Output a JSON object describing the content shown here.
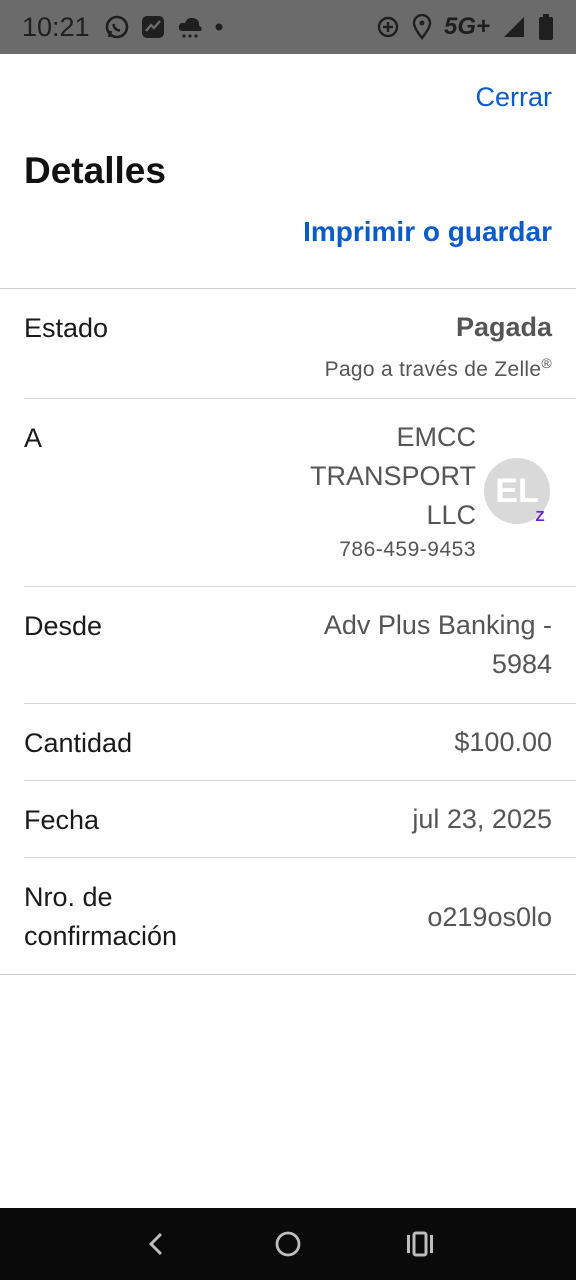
{
  "status_bar": {
    "time": "10:21",
    "network": "5G+",
    "left_icons": [
      "whatsapp-icon",
      "chart-app-icon",
      "weather-icon",
      "dot-icon"
    ],
    "right_icons": [
      "data-saver-icon",
      "location-icon",
      "signal-icon",
      "battery-icon"
    ]
  },
  "header": {
    "close_label": "Cerrar",
    "title": "Detalles",
    "print_label": "Imprimir o guardar"
  },
  "details": {
    "status": {
      "label": "Estado",
      "value": "Pagada",
      "sub_text": "Pago a través de Zelle",
      "sub_mark": "®"
    },
    "to": {
      "label": "A",
      "name": "EMCC TRANSPORT LLC",
      "phone": "786-459-9453",
      "avatar_initials": "EL",
      "badge": "Z"
    },
    "from": {
      "label": "Desde",
      "value": "Adv Plus Banking - 5984"
    },
    "amount": {
      "label": "Cantidad",
      "value": "$100.00"
    },
    "date": {
      "label": "Fecha",
      "value": "jul 23, 2025"
    },
    "confirmation": {
      "label": "Nro. de confirmación",
      "value": "o219os0lo"
    }
  },
  "nav_bar": {
    "icons": [
      "back-icon",
      "home-icon",
      "recents-icon"
    ]
  },
  "colors": {
    "accent": "#0b5bc8",
    "zelle_purple": "#6d1ed4"
  }
}
